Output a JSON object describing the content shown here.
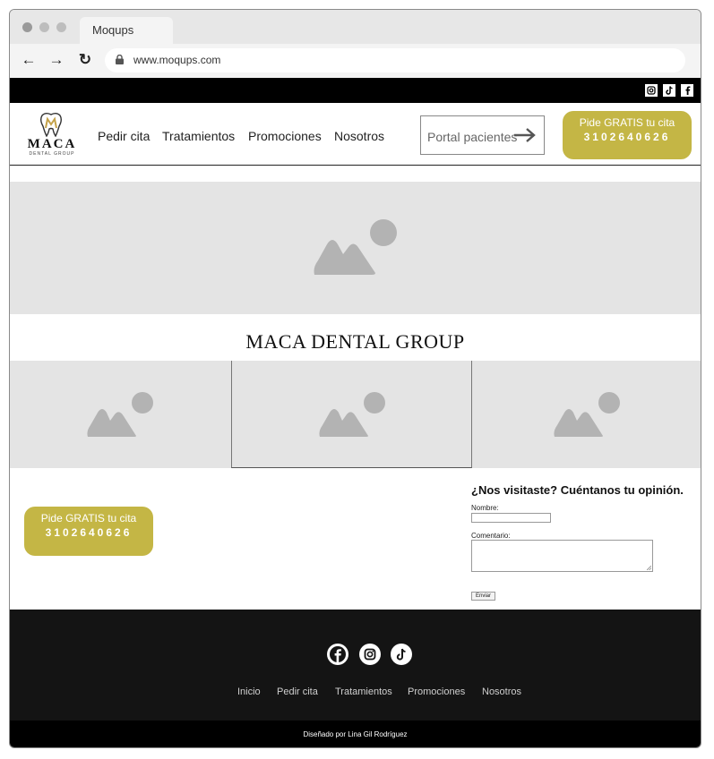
{
  "browser": {
    "tab_title": "Moqups",
    "url": "www.moqups.com",
    "back_icon": "←",
    "forward_icon": "→",
    "reload_icon": "↻"
  },
  "topbar": {
    "social": [
      {
        "name": "instagram-icon",
        "glyph": "◎"
      },
      {
        "name": "tiktok-icon",
        "glyph": "♪"
      },
      {
        "name": "facebook-icon",
        "glyph": "f"
      }
    ]
  },
  "header": {
    "logo_text": "MACA",
    "logo_sub": "DENTAL GROUP",
    "nav": [
      "Pedir cita",
      "Tratamientos",
      "Promociones",
      "Nosotros"
    ],
    "portal_label": "Portal pacientes",
    "cta_line1": "Pide GRATIS tu cita",
    "cta_line2": "3102640626"
  },
  "main": {
    "title": "MACA DENTAL GROUP",
    "cta_line1": "Pide GRATIS tu cita",
    "cta_line2": "3102640626"
  },
  "form": {
    "title": "¿Nos visitaste? Cuéntanos tu opinión.",
    "name_label": "Nombre:",
    "comment_label": "Comentario:",
    "submit_label": "Enviar"
  },
  "footer": {
    "social": [
      {
        "name": "facebook-icon",
        "glyph": "f"
      },
      {
        "name": "instagram-icon",
        "glyph": "◎"
      },
      {
        "name": "tiktok-icon",
        "glyph": "♪"
      }
    ],
    "links": [
      "Inicio",
      "Pedir cita",
      "Tratamientos",
      "Promociones",
      "Nosotros"
    ],
    "credit": "Diseñado por Lina Gil Rodríguez"
  },
  "colors": {
    "accent": "#c4b645",
    "placeholder": "#e4e4e4",
    "dark": "#141414"
  }
}
